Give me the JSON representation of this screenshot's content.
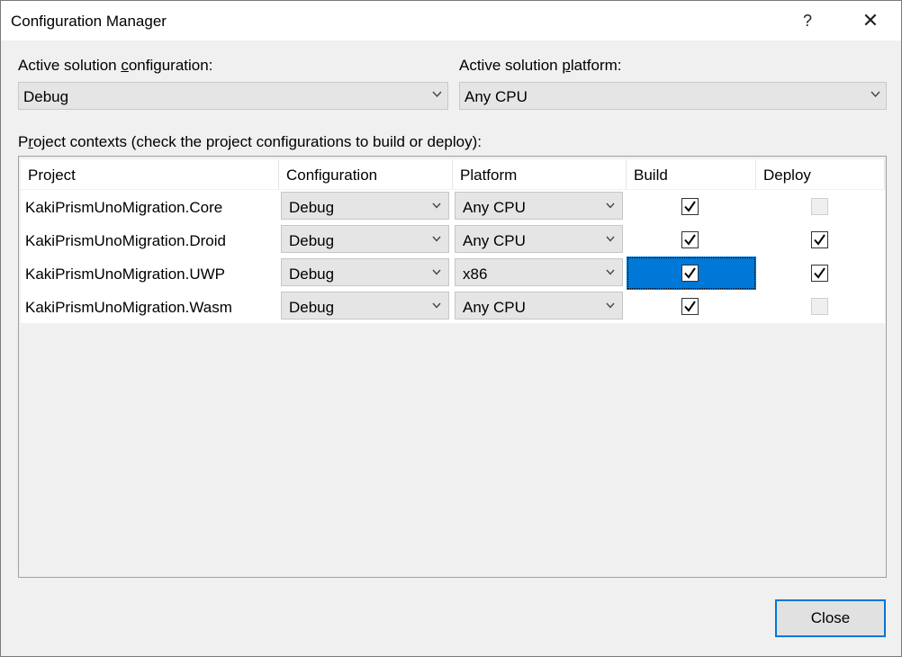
{
  "window": {
    "title": "Configuration Manager",
    "help_glyph": "?",
    "close_glyph": "✕"
  },
  "solution": {
    "config_label_pre": "Active solution ",
    "config_label_acc": "c",
    "config_label_post": "onfiguration:",
    "config_value": "Debug",
    "platform_label_pre": "Active solution ",
    "platform_label_acc": "p",
    "platform_label_post": "latform:",
    "platform_value": "Any CPU"
  },
  "contexts": {
    "label_pre": "P",
    "label_acc": "r",
    "label_post": "oject contexts (check the project configurations to build or deploy):"
  },
  "table": {
    "headers": [
      "Project",
      "Configuration",
      "Platform",
      "Build",
      "Deploy"
    ],
    "rows": [
      {
        "project": "KakiPrismUnoMigration.Core",
        "configuration": "Debug",
        "platform": "Any CPU",
        "build": true,
        "deploy": false,
        "deploy_enabled": false
      },
      {
        "project": "KakiPrismUnoMigration.Droid",
        "configuration": "Debug",
        "platform": "Any CPU",
        "build": true,
        "deploy": true,
        "deploy_enabled": true
      },
      {
        "project": "KakiPrismUnoMigration.UWP",
        "configuration": "Debug",
        "platform": "x86",
        "build": true,
        "deploy": true,
        "deploy_enabled": true
      },
      {
        "project": "KakiPrismUnoMigration.Wasm",
        "configuration": "Debug",
        "platform": "Any CPU",
        "build": true,
        "deploy": false,
        "deploy_enabled": false
      }
    ]
  },
  "buttons": {
    "close_label": "Close"
  },
  "colors": {
    "selection": "#0078d7",
    "dialog_bg": "#f0f0f0"
  }
}
